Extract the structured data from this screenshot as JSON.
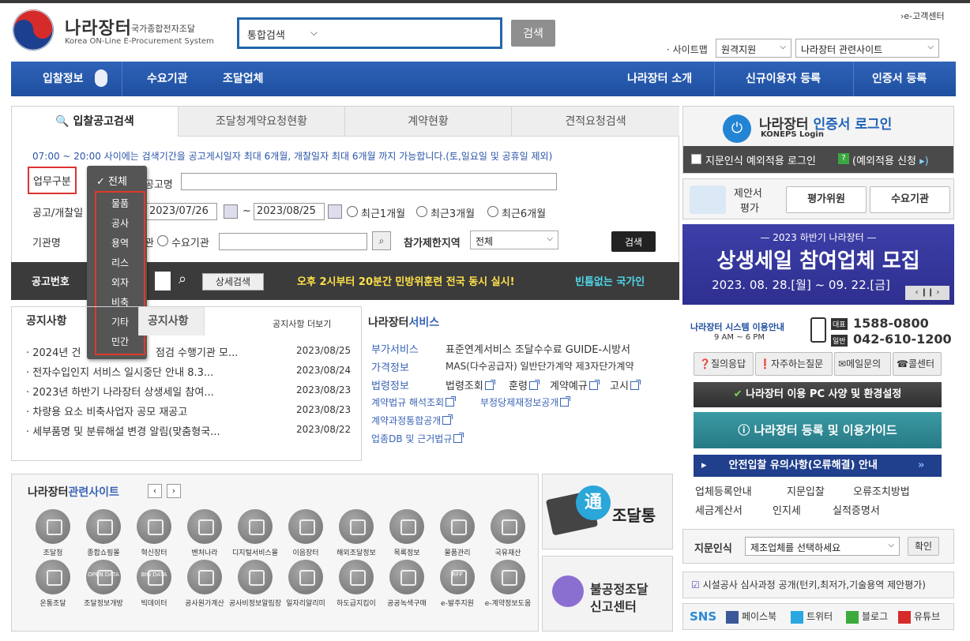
{
  "header": {
    "logo_title": "나라장터",
    "logo_subtitle": "국가종합전자조달",
    "logo_english": "Korea ON-Line E-Procurement System",
    "search_type": "통합검색",
    "search_button": "검색",
    "cs_link": "›e-고객센터",
    "sitemap_label": "· 사이트맵",
    "remote_select": "원격지원",
    "related_select": "나라장터 관련사이트"
  },
  "nav": {
    "bid_info": "입찰정보",
    "demand_org": "수요기관",
    "supplier": "조달업체",
    "intro": "나라장터 소개",
    "new_user": "신규이용자 등록",
    "cert_reg": "인증서 등록"
  },
  "tabs": [
    "입찰공고검색",
    "조달청계약요청현황",
    "계약현황",
    "견적요청검색"
  ],
  "search_form": {
    "notice": "07:00 ~ 20:00 사이에는 검색기간을 공고게시일자 최대 6개월, 개찰일자 최대 6개월 까지 가능합니다.(토,일요일 및 공휴일 제외)",
    "biz_type_label": "업무구분",
    "biz_type_options": [
      "전체",
      "물품",
      "공사",
      "용역",
      "리스",
      "외자",
      "비축",
      "기타",
      "민간"
    ],
    "notice_name_label": "공고명",
    "date_label": "공고/개찰일",
    "date_from": "2023/07/26",
    "date_tilde": "~",
    "date_to": "2023/08/25",
    "recent_1": "최근1개월",
    "recent_3": "최근3개월",
    "recent_6": "최근6개월",
    "org_label": "기관명",
    "org_opt_a": "관",
    "org_opt_b": "수요기관",
    "region_label": "참가제한지역",
    "region_value": "전체",
    "search_button": "검색",
    "notice_no_label": "공고번호",
    "detail_search": "상세검색",
    "ticker_yellow": "오후 2시부터 20분간 민방위훈련 전국 동시 실시!",
    "ticker_cyan": "빈틈없는 국가인"
  },
  "notices": {
    "tab_main": "공지사항",
    "tab_second": "공지사항",
    "more": "공지사항 더보기",
    "items": [
      {
        "title": "· 2024년 건",
        "title2": "점검 수행기관 모...",
        "date": "2023/08/25"
      },
      {
        "title": "· 전자수입인지 서비스 일시중단 안내 8.3...",
        "date": "2023/08/24"
      },
      {
        "title": "· 2023년 하반기 나라장터 상생세일 참여...",
        "date": "2023/08/23"
      },
      {
        "title": "· 차량용 요소 비축사업자 공모 재공고",
        "date": "2023/08/23"
      },
      {
        "title": "· 세부품명 및 분류해설 변경 알림(맞춤형국...",
        "date": "2023/08/22"
      }
    ]
  },
  "services": {
    "title_a": "나라장터",
    "title_b": "서비스",
    "r1_label": "부가서비스",
    "r1_value": "표준연계서비스  조달수수료  GUIDE-시방서",
    "r2_label": "가격정보",
    "r2_value": "MAS(다수공급자)  일반단가계약  제3자단가계약",
    "r3_label": "법령정보",
    "r3_a": "법령조회",
    "r3_b": "훈령",
    "r3_c": "계약예규",
    "r3_d": "고시",
    "r4_a": "계약법규 해석조회",
    "r4_b": "부정당제재정보공개",
    "r5": "계약과정통합공개",
    "r6": "업종DB 및 근거법규"
  },
  "related": {
    "title_a": "나라장터",
    "title_b": "관련사이트",
    "row1": [
      "조달청",
      "종합쇼핑몰",
      "혁신장터",
      "벤처나라",
      "디지털서비스몰",
      "이음장터",
      "해외조달정보",
      "목록정보",
      "물품관리",
      "국유재산"
    ],
    "row2": [
      "온통조달",
      "조달정보개방",
      "빅데이터",
      "공사원가계산",
      "공사비정보알림장",
      "일자리알리미",
      "하도급지킴이",
      "공공녹색구매",
      "e-발주지원",
      "e-계약정보도움"
    ],
    "icon_text_open": "OPEN DATA",
    "icon_text_big": "BIG DATA",
    "icon_text_rfp": "RFP"
  },
  "promo": {
    "jodal": "조달통",
    "jodal_char": "通",
    "unfair_1": "불공정조달",
    "unfair_2": "신고센터"
  },
  "right": {
    "login_a": "나라장터 ",
    "login_b": "인증서 로그인",
    "koneps": "KONEPS Login",
    "fingerprint_login": "지문인식 예외적용 로그인",
    "fingerprint_apply": "(예외적용 신청",
    "proposal_1": "제안서",
    "proposal_2": "평가",
    "evaluator": "평가위원",
    "demand": "수요기관",
    "banner_top": "— 2023 하반기 나라장터 —",
    "banner_main": "상생세일 참여업체 모집",
    "banner_date": "2023. 08. 28.[월] ~ 09. 22.[금]",
    "sys_guide": "나라장터 시스템 이용안내",
    "sys_hours": "9 AM ~ 6 PM",
    "tel_label": "대표",
    "tel": "1588-0800",
    "tel2_label": "일반",
    "tel2": "042-610-1200",
    "qa": "질의응답",
    "faq": "자주하는질문",
    "email": "메일문의",
    "callcenter": "콜센터",
    "pc_spec": "나라장터 이용 PC 사양 및 환경설정",
    "register_guide": "나라장터 등록 및 이용가이드",
    "safe_bid": "안전입찰 유의사항(오류해결) 안내",
    "links": [
      "업체등록안내",
      "지문입찰",
      "오류조치방법",
      "세금계산서",
      "인지세",
      "실적증명서"
    ],
    "fp_label": "지문인식",
    "fp_select": "제조업체를 선택하세요",
    "fp_confirm": "확인",
    "facility": "시설공사 심사과정 공개(턴키,최저가,기술용역 제안평가)",
    "sns": "SNS",
    "facebook": "페이스북",
    "twitter": "트위터",
    "blog": "블로그",
    "youtube": "유튜브"
  }
}
